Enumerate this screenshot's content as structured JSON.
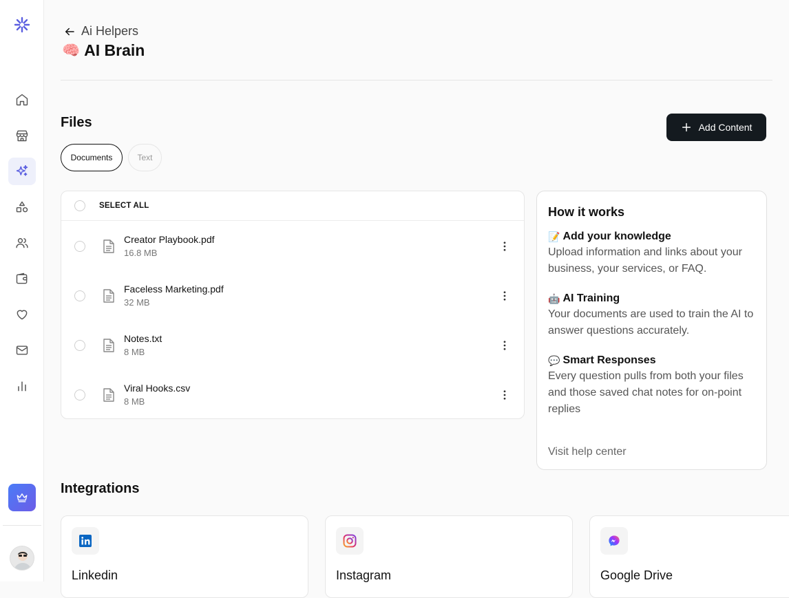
{
  "header": {
    "back_label": "Ai Helpers",
    "title_emoji": "🧠",
    "title": "AI Brain"
  },
  "files": {
    "title": "Files",
    "add_button_label": "Add Content",
    "tabs": [
      {
        "label": "Documents",
        "active": true
      },
      {
        "label": "Text",
        "active": false
      }
    ],
    "select_all_label": "SELECT ALL",
    "items": [
      {
        "name": "Creator Playbook.pdf",
        "size": "16.8 MB"
      },
      {
        "name": "Faceless Marketing.pdf",
        "size": "32 MB"
      },
      {
        "name": "Notes.txt",
        "size": "8 MB"
      },
      {
        "name": "Viral Hooks.csv",
        "size": "8 MB"
      }
    ]
  },
  "how_it_works": {
    "title": "How it works",
    "steps": [
      {
        "emoji": "📝",
        "title": "Add your knowledge",
        "text": "Upload information and links about your business, your services, or FAQ."
      },
      {
        "emoji": "🤖",
        "title": "AI Training",
        "text": "Your documents are used to train the AI to answer questions accurately."
      },
      {
        "emoji": "💬",
        "title": "Smart Responses",
        "text": "Every question pulls from both your files and those saved chat notes for on-point replies"
      }
    ],
    "help_link": "Visit help center"
  },
  "integrations": {
    "title": "Integrations",
    "items": [
      {
        "name": "Linkedin",
        "icon": "linkedin-icon"
      },
      {
        "name": "Instagram",
        "icon": "instagram-icon"
      },
      {
        "name": "Google Drive",
        "icon": "messenger-icon"
      }
    ]
  },
  "sidebar": {
    "items": [
      {
        "icon": "home-icon"
      },
      {
        "icon": "store-icon"
      },
      {
        "icon": "sparkles-icon",
        "active": true
      },
      {
        "icon": "shapes-icon"
      },
      {
        "icon": "users-icon"
      },
      {
        "icon": "wallet-icon"
      },
      {
        "icon": "heart-icon"
      },
      {
        "icon": "mail-icon"
      },
      {
        "icon": "bar-chart-icon"
      }
    ]
  },
  "colors": {
    "accent": "#5b5fe0",
    "primary_button": "#141a1f"
  }
}
